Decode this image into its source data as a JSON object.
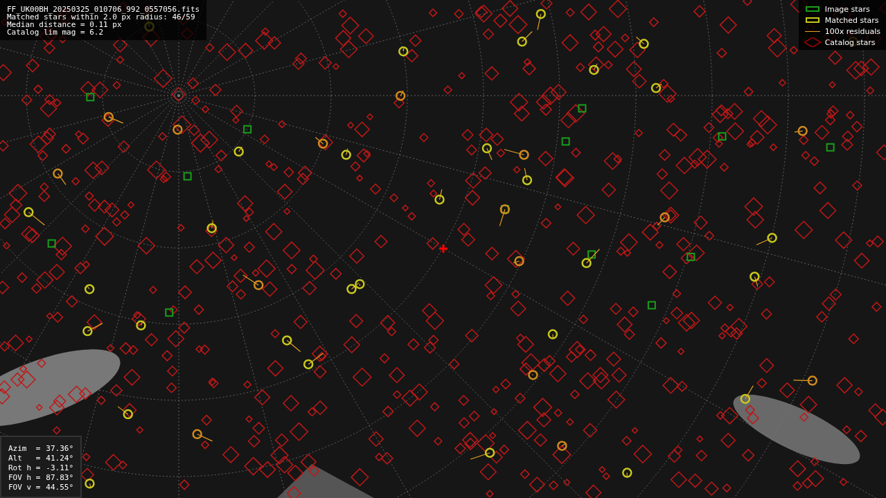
{
  "info": {
    "lines": [
      "FF_UK00BH_20250325_010706_992_0557056.fits",
      "Matched stars within 2.0 px radius: 46/59",
      "Median distance = 0.11 px",
      "Catalog lim mag = 6.2"
    ]
  },
  "legend": [
    {
      "kind": "image",
      "label": "Image stars"
    },
    {
      "kind": "matched",
      "label": "Matched stars"
    },
    {
      "kind": "residual",
      "label": "100x residuals"
    },
    {
      "kind": "catalog",
      "label": "Catalog stars"
    }
  ],
  "pointing": [
    {
      "label": "Azim  =",
      "value": "37.36°"
    },
    {
      "label": "Alt   =",
      "value": "41.24°"
    },
    {
      "label": "Rot h =",
      "value": "-3.11°"
    },
    {
      "label": "FOV h =",
      "value": "87.83°"
    },
    {
      "label": "FOV v =",
      "value": "44.55°"
    }
  ]
}
